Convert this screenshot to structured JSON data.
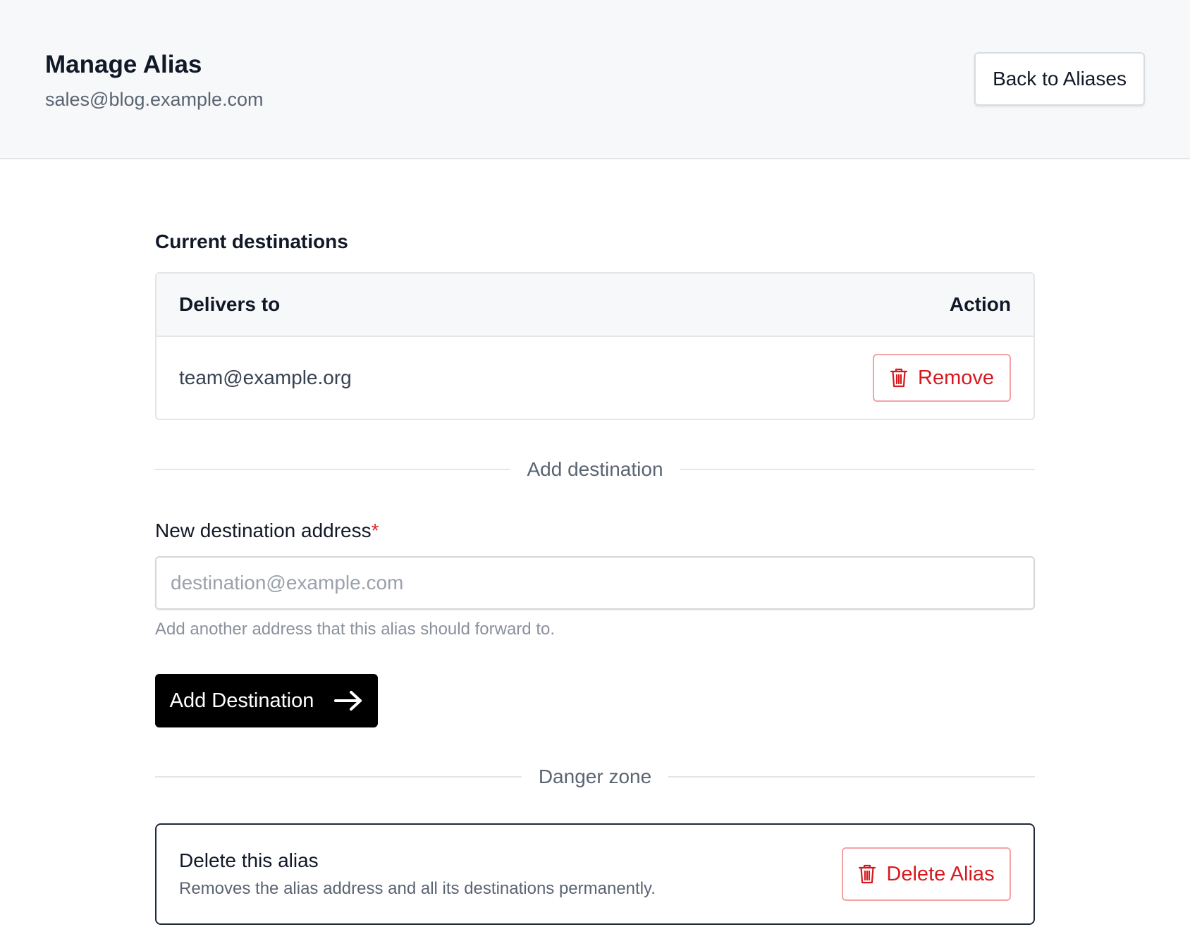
{
  "header": {
    "title": "Manage Alias",
    "alias_address": "sales@blog.example.com",
    "back_button_label": "Back to Aliases"
  },
  "destinations": {
    "section_title": "Current destinations",
    "columns": {
      "delivers_to": "Delivers to",
      "action": "Action"
    },
    "rows": [
      {
        "address": "team@example.org",
        "action_label": "Remove",
        "action_icon": "trash-icon"
      }
    ]
  },
  "add_destination": {
    "divider_label": "Add destination",
    "field_label": "New destination address",
    "required_marker": "*",
    "input_value": "",
    "input_placeholder": "destination@example.com",
    "help_text": "Add another address that this alias should forward to.",
    "submit_label": "Add Destination",
    "submit_icon": "arrow-right-icon"
  },
  "danger_zone": {
    "divider_label": "Danger zone",
    "title": "Delete this alias",
    "description": "Removes the alias address and all its destinations permanently.",
    "delete_button_label": "Delete Alias",
    "delete_button_icon": "trash-icon"
  },
  "colors": {
    "header_bg": "#f7f8f9",
    "danger": "#d7191f",
    "danger_border": "#f3a3a8",
    "primary_button_bg": "#000000",
    "muted_text": "#5b6472"
  }
}
